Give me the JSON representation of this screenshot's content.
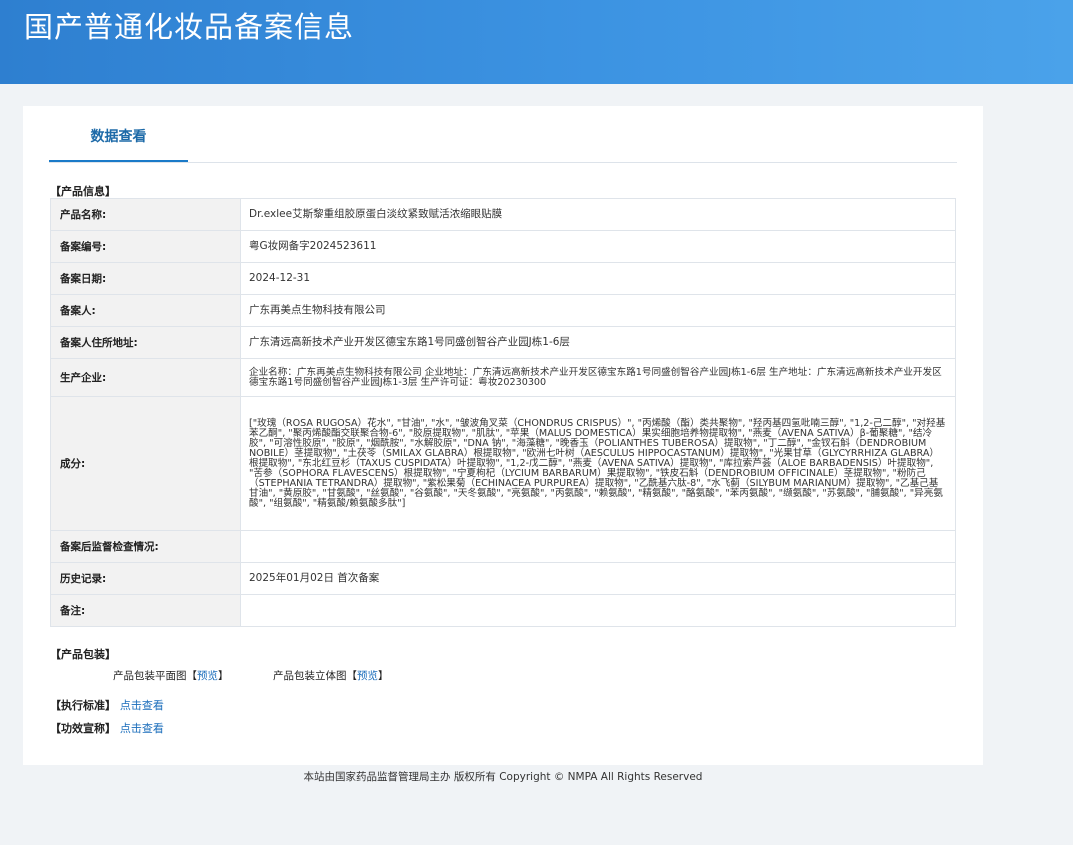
{
  "header": {
    "title": "国产普通化妆品备案信息"
  },
  "tabs": [
    {
      "label": "数据查看"
    }
  ],
  "product_info": {
    "section_label": "【产品信息】",
    "rows": [
      {
        "key": "产品名称:",
        "value": "Dr.exlee艾斯黎重组胶原蛋白淡纹紧致赋活浓缩眼贴膜"
      },
      {
        "key": "备案编号:",
        "value": "粤G妆网备字2024523611"
      },
      {
        "key": "备案日期:",
        "value": "2024-12-31"
      },
      {
        "key": "备案人:",
        "value": "广东再美点生物科技有限公司"
      },
      {
        "key": "备案人住所地址:",
        "value": "广东清远高新技术产业开发区德宝东路1号同盛创智谷产业园J栋1-6层"
      },
      {
        "key": "生产企业:",
        "value": "企业名称：广东再美点生物科技有限公司 企业地址：广东清远高新技术产业开发区德宝东路1号同盛创智谷产业园J栋1-6层 生产地址：广东清远高新技术产业开发区德宝东路1号同盛创智谷产业园J栋1-3层 生产许可证：粤妆20230300"
      },
      {
        "key": "成分:",
        "value": "[\"玫瑰（ROSA RUGOSA）花水\", \"甘油\", \"水\", \"皱波角叉菜（CHONDRUS CRISPUS）\", \"丙烯酸（酯）类共聚物\", \"羟丙基四氢吡喃三醇\", \"1,2-己二醇\", \"对羟基苯乙酮\", \"聚丙烯酸酯交联聚合物-6\", \"胶原提取物\", \"肌肽\", \"苹果（MALUS DOMESTICA）果实细胞培养物提取物\", \"燕麦（AVENA SATIVA）β-葡聚糖\", \"结冷胶\", \"可溶性胶原\", \"胶原\", \"烟酰胺\", \"水解胶原\", \"DNA 钠\", \"海藻糖\", \"晚香玉（POLIANTHES TUBEROSA）提取物\", \"丁二醇\", \"金钗石斛（DENDROBIUM NOBILE）茎提取物\", \"土茯苓（SMILAX GLABRA）根提取物\", \"欧洲七叶树（AESCULUS HIPPOCASTANUM）提取物\", \"光果甘草（GLYCYRRHIZA GLABRA）根提取物\", \"东北红豆杉（TAXUS CUSPIDATA）叶提取物\", \"1,2-戊二醇\", \"燕麦（AVENA SATIVA）提取物\", \"库拉索芦荟（ALOE BARBADENSIS）叶提取物\", \"苦参（SOPHORA FLAVESCENS）根提取物\", \"宁夏枸杞（LYCIUM BARBARUM）果提取物\", \"铁皮石斛（DENDROBIUM OFFICINALE）茎提取物\", \"粉防己（STEPHANIA TETRANDRA）提取物\", \"紫松果菊（ECHINACEA PURPUREA）提取物\", \"乙酰基六肽-8\", \"水飞蓟（SILYBUM MARIANUM）提取物\", \"乙基己基甘油\", \"黄原胶\", \"甘氨酸\", \"丝氨酸\", \"谷氨酸\", \"天冬氨酸\", \"亮氨酸\", \"丙氨酸\", \"赖氨酸\", \"精氨酸\", \"酪氨酸\", \"苯丙氨酸\", \"缬氨酸\", \"苏氨酸\", \"脯氨酸\", \"异亮氨酸\", \"组氨酸\", \"精氨酸/赖氨酸多肽\"]"
      },
      {
        "key": "备案后监督检查情况:",
        "value": ""
      },
      {
        "key": "历史记录:",
        "value": "2025年01月02日 首次备案"
      },
      {
        "key": "备注:",
        "value": ""
      }
    ]
  },
  "packaging": {
    "section_label": "【产品包装】",
    "flat": {
      "label": "产品包装平面图",
      "bracket_open": "【",
      "link": "预览",
      "bracket_close": "】"
    },
    "stereo": {
      "label": "产品包装立体图",
      "bracket_open": "【",
      "link": "预览",
      "bracket_close": "】"
    }
  },
  "standard": {
    "label": "【执行标准】",
    "link": "点击查看"
  },
  "efficacy": {
    "label": "【功效宣称】",
    "link": "点击查看"
  },
  "footer": {
    "text": "本站由国家药品监督管理局主办 版权所有 Copyright © NMPA All Rights Reserved"
  },
  "colors": {
    "header": "#3a8fde",
    "tab_accent": "#1a7ac8",
    "link": "#1a6dbb",
    "page_bg": "#f0f3f6"
  }
}
